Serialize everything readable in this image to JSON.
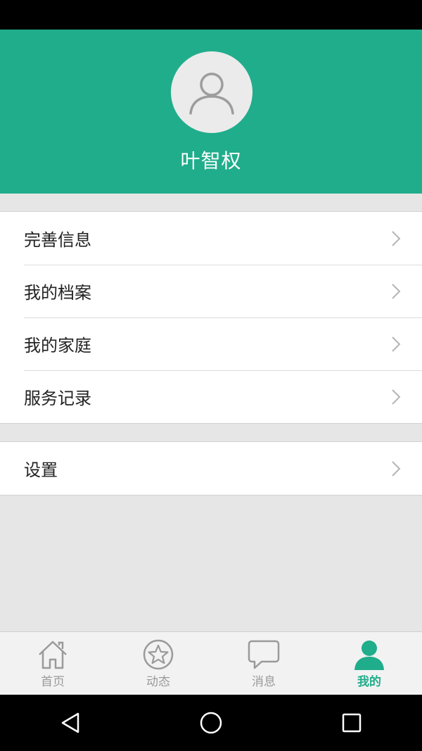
{
  "profile": {
    "username": "叶智权"
  },
  "menu_group_1": {
    "items": [
      {
        "label": "完善信息"
      },
      {
        "label": "我的档案"
      },
      {
        "label": "我的家庭"
      },
      {
        "label": "服务记录"
      }
    ]
  },
  "menu_group_2": {
    "items": [
      {
        "label": "设置"
      }
    ]
  },
  "tabs": [
    {
      "label": "首页",
      "icon": "home-icon"
    },
    {
      "label": "动态",
      "icon": "star-icon"
    },
    {
      "label": "消息",
      "icon": "chat-icon"
    },
    {
      "label": "我的",
      "icon": "person-icon",
      "active": true
    }
  ],
  "colors": {
    "accent": "#20ad8b",
    "background": "#e6e6e6",
    "tab_inactive": "#9a9a9a"
  }
}
